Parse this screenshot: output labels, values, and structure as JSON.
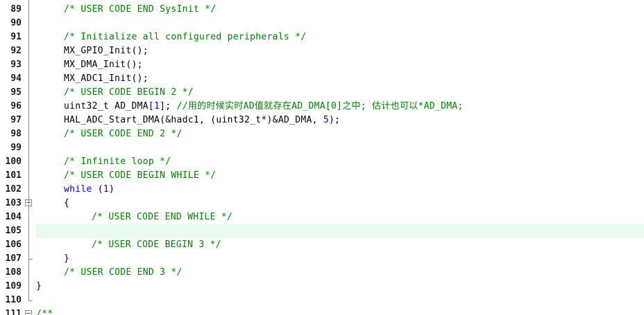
{
  "editor": {
    "lines": [
      {
        "num": "89",
        "indent": 1,
        "segs": [
          {
            "t": "/* USER CODE END SysInit */",
            "k": "cm"
          }
        ]
      },
      {
        "num": "90",
        "indent": 0,
        "segs": []
      },
      {
        "num": "91",
        "indent": 1,
        "segs": [
          {
            "t": "/* Initialize all configured peripherals */",
            "k": "cm"
          }
        ]
      },
      {
        "num": "92",
        "indent": 1,
        "segs": [
          {
            "t": "MX_GPIO_Init();",
            "k": "df"
          }
        ]
      },
      {
        "num": "93",
        "indent": 1,
        "segs": [
          {
            "t": "MX_DMA_Init();",
            "k": "df"
          }
        ]
      },
      {
        "num": "94",
        "indent": 1,
        "segs": [
          {
            "t": "MX_ADC1_Init();",
            "k": "df"
          }
        ]
      },
      {
        "num": "95",
        "indent": 1,
        "segs": [
          {
            "t": "/* USER CODE BEGIN 2 */",
            "k": "cm"
          }
        ]
      },
      {
        "num": "96",
        "indent": 1,
        "segs": [
          {
            "t": "uint32_t AD_DMA[",
            "k": "df"
          },
          {
            "t": "1",
            "k": "num"
          },
          {
            "t": "]; ",
            "k": "df"
          },
          {
            "t": "//用的时候实时AD值就存在AD_DMA[0]之中; 估计也可以*AD_DMA;",
            "k": "cm"
          }
        ]
      },
      {
        "num": "97",
        "indent": 1,
        "segs": [
          {
            "t": "HAL_ADC_Start_DMA(&hadc1, (uint32_t*)&AD_DMA, ",
            "k": "df"
          },
          {
            "t": "5",
            "k": "num"
          },
          {
            "t": ");",
            "k": "df"
          }
        ]
      },
      {
        "num": "98",
        "indent": 1,
        "segs": [
          {
            "t": "/* USER CODE END 2 */",
            "k": "cm"
          }
        ]
      },
      {
        "num": "99",
        "indent": 0,
        "segs": []
      },
      {
        "num": "100",
        "indent": 1,
        "segs": [
          {
            "t": "/* Infinite loop */",
            "k": "cm"
          }
        ]
      },
      {
        "num": "101",
        "indent": 1,
        "segs": [
          {
            "t": "/* USER CODE BEGIN WHILE */",
            "k": "cm"
          }
        ]
      },
      {
        "num": "102",
        "indent": 1,
        "segs": [
          {
            "t": "while",
            "k": "kw"
          },
          {
            "t": " (",
            "k": "df"
          },
          {
            "t": "1",
            "k": "num"
          },
          {
            "t": ")",
            "k": "df"
          }
        ]
      },
      {
        "num": "103",
        "indent": 1,
        "fold": "open",
        "segs": [
          {
            "t": "{",
            "k": "df"
          }
        ]
      },
      {
        "num": "104",
        "indent": 2,
        "segs": [
          {
            "t": "/* USER CODE END WHILE */",
            "k": "cm"
          }
        ]
      },
      {
        "num": "105",
        "indent": 0,
        "active": true,
        "segs": []
      },
      {
        "num": "106",
        "indent": 2,
        "segs": [
          {
            "t": "/* USER CODE BEGIN 3 */",
            "k": "cm"
          }
        ]
      },
      {
        "num": "107",
        "indent": 1,
        "fold": "end",
        "segs": [
          {
            "t": "}",
            "k": "df"
          }
        ]
      },
      {
        "num": "108",
        "indent": 1,
        "segs": [
          {
            "t": "/* USER CODE END 3 */",
            "k": "cm"
          }
        ]
      },
      {
        "num": "109",
        "indent": 0,
        "segs": [
          {
            "t": "}",
            "k": "df"
          }
        ]
      },
      {
        "num": "110",
        "indent": 0,
        "fold": "end",
        "segs": []
      },
      {
        "num": "111",
        "indent": 0,
        "fold": "open",
        "segs": [
          {
            "t": "/**",
            "k": "cm"
          }
        ]
      }
    ]
  }
}
